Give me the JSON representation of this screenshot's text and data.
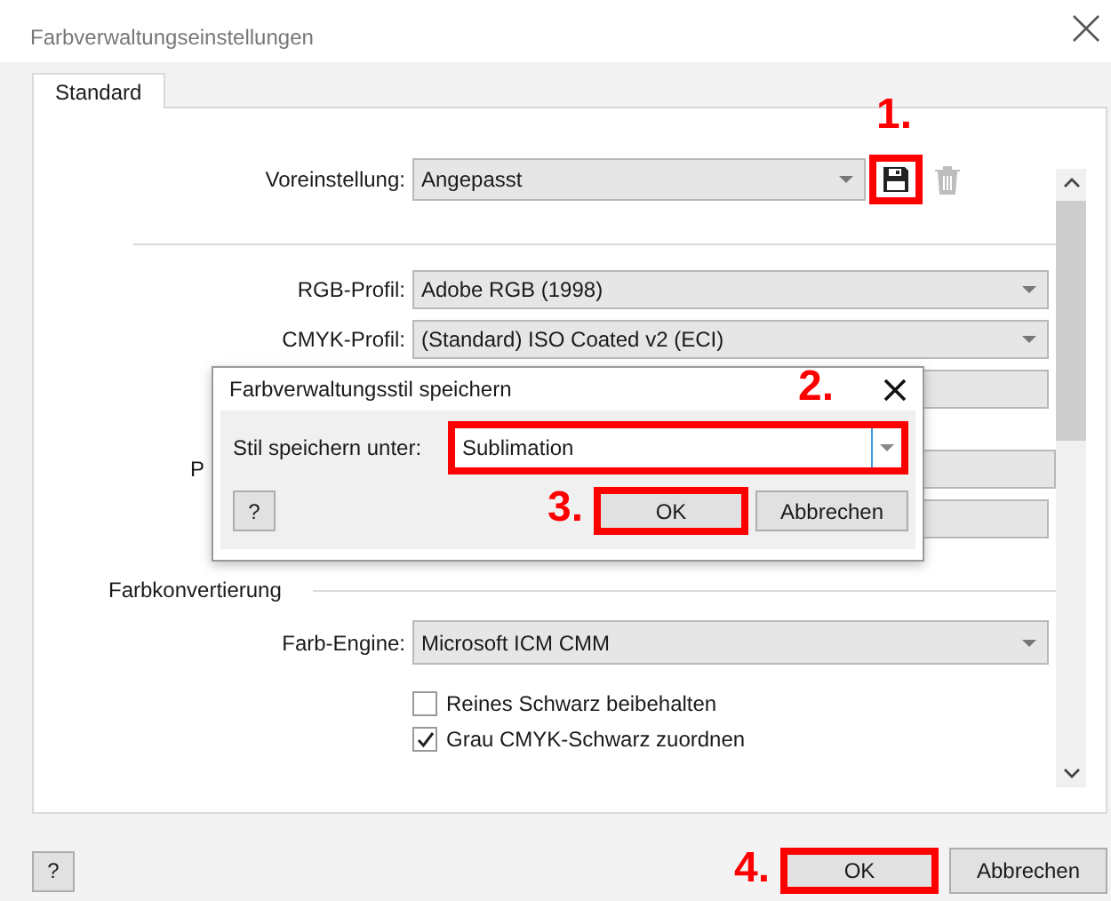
{
  "window": {
    "title": "Farbverwaltungseinstellungen"
  },
  "tabs": [
    {
      "label": "Standard",
      "selected": true
    }
  ],
  "preset": {
    "label": "Voreinstellung:",
    "value": "Angepasst",
    "save_highlighted": true,
    "annotation": "1."
  },
  "profiles": [
    {
      "kind": "combo",
      "label": "RGB-Profil:",
      "value": "Adobe RGB (1998)"
    },
    {
      "kind": "combo",
      "label": "CMYK-Profil:",
      "value": "(Standard) ISO Coated v2 (ECI)"
    },
    {
      "kind": "combo"
    },
    {
      "kind": "gap"
    },
    {
      "kind": "combo",
      "label": "P"
    },
    {
      "kind": "combo"
    }
  ],
  "conversion": {
    "heading": "Farbkonvertierung",
    "engine": {
      "label": "Farb-Engine:",
      "value": "Microsoft ICM CMM"
    },
    "options": [
      {
        "label": "Reines Schwarz beibehalten",
        "checked": false
      },
      {
        "label": "Grau CMYK-Schwarz zuordnen",
        "checked": true
      }
    ]
  },
  "footer": {
    "help": "?",
    "buttons": [
      {
        "label": "OK",
        "highlighted": true,
        "annotation": "4."
      },
      {
        "label": "Abbrechen",
        "highlighted": false
      }
    ]
  },
  "dialog": {
    "title": "Farbverwaltungsstil speichern",
    "field_label": "Stil speichern unter:",
    "value": "Sublimation",
    "field_highlighted": true,
    "field_annotation": "2.",
    "help": "?",
    "buttons": [
      {
        "label": "OK",
        "highlighted": true,
        "annotation": "3."
      },
      {
        "label": "Abbrechen",
        "highlighted": false
      }
    ]
  }
}
